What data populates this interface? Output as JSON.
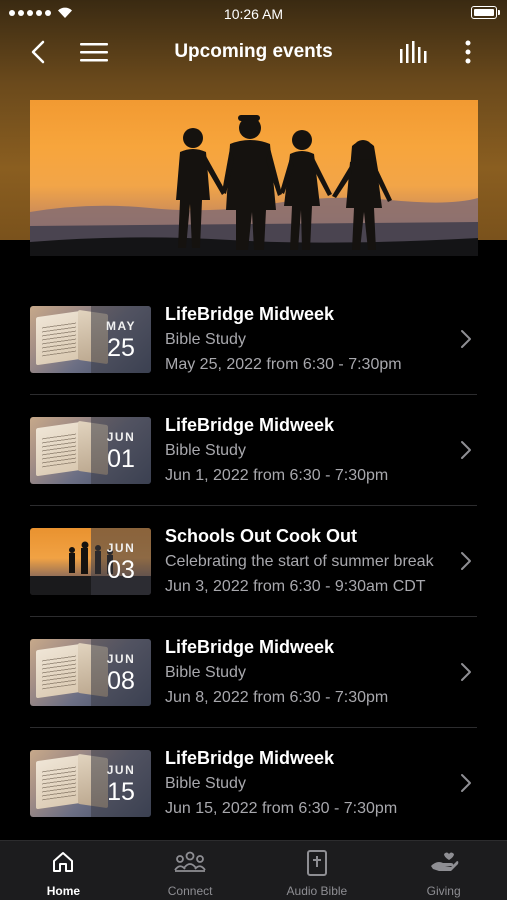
{
  "status_bar": {
    "time": "10:26 AM"
  },
  "nav": {
    "title": "Upcoming events",
    "back_icon": "chevron-left-icon",
    "menu_icon": "hamburger-icon",
    "stats_icon": "equalizer-icon",
    "more_icon": "more-vertical-icon"
  },
  "hero": {
    "image": "family-silhouette-sunset"
  },
  "events": [
    {
      "title": "LifeBridge Midweek",
      "subtitle": "Bible Study",
      "date_text": "May 25, 2022 from 6:30 - 7:30pm",
      "month": "MAY",
      "day": "25",
      "thumbnail": "bible"
    },
    {
      "title": "LifeBridge Midweek",
      "subtitle": "Bible Study",
      "date_text": "Jun 1, 2022 from 6:30 - 7:30pm",
      "month": "JUN",
      "day": "01",
      "thumbnail": "bible"
    },
    {
      "title": "Schools Out Cook Out",
      "subtitle": "Celebrating the start of summer break",
      "date_text": "Jun 3, 2022 from 6:30 - 9:30am CDT",
      "month": "JUN",
      "day": "03",
      "thumbnail": "sunset-silhouettes"
    },
    {
      "title": "LifeBridge Midweek",
      "subtitle": "Bible Study",
      "date_text": "Jun 8, 2022 from 6:30 - 7:30pm",
      "month": "JUN",
      "day": "08",
      "thumbnail": "bible"
    },
    {
      "title": "LifeBridge Midweek",
      "subtitle": "Bible Study",
      "date_text": "Jun 15, 2022 from 6:30 - 7:30pm",
      "month": "JUN",
      "day": "15",
      "thumbnail": "bible"
    }
  ],
  "tabs": [
    {
      "label": "Home",
      "icon": "home-icon",
      "active": true
    },
    {
      "label": "Connect",
      "icon": "people-icon",
      "active": false
    },
    {
      "label": "Audio Bible",
      "icon": "bible-cross-icon",
      "active": false
    },
    {
      "label": "Giving",
      "icon": "giving-hand-icon",
      "active": false
    }
  ],
  "colors": {
    "accent": "#f7a53c",
    "header_gradient": "#8a5e20",
    "background": "#000000",
    "secondary_text": "#a8a8ad"
  }
}
